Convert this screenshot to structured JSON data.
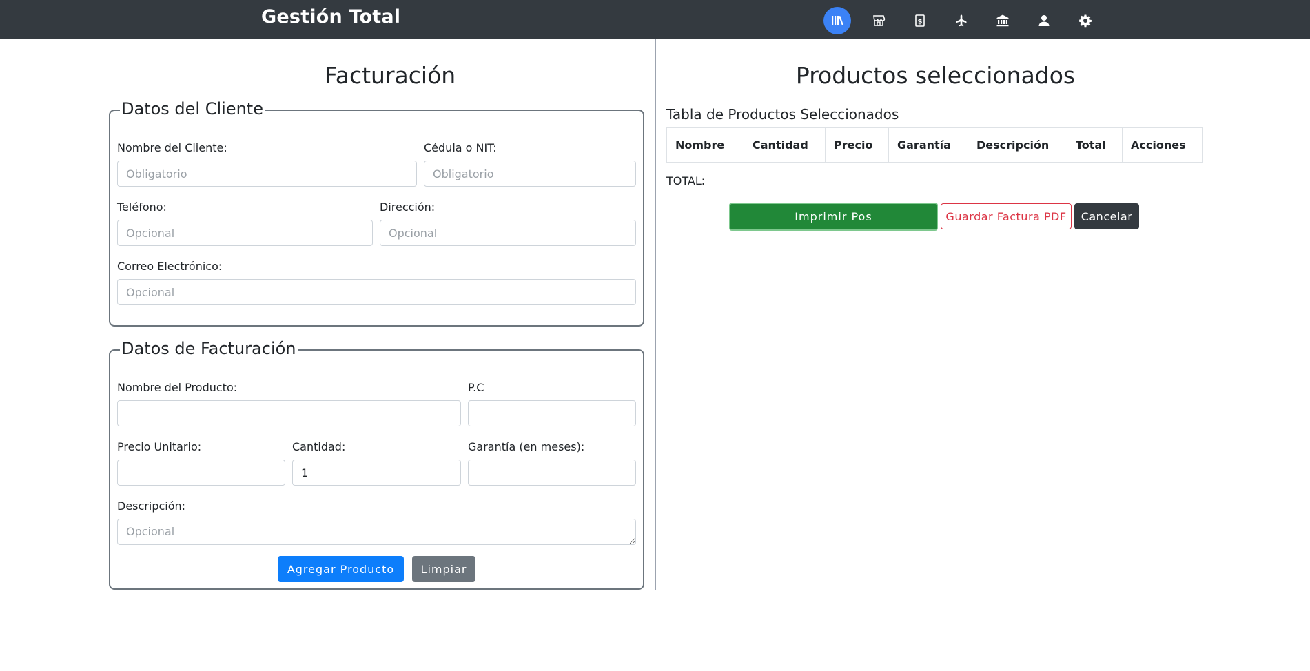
{
  "navbar": {
    "brand": "Gestión Total",
    "icons": [
      "books-icon",
      "store-icon",
      "invoice-dollar-icon",
      "plane-icon",
      "bank-icon",
      "user-icon",
      "gear-icon"
    ],
    "active_color": "#3b82f6"
  },
  "billing": {
    "title": "Facturación",
    "client": {
      "legend": "Datos del Cliente",
      "name_label": "Nombre del Cliente:",
      "name_placeholder": "Obligatorio",
      "id_label": "Cédula o NIT:",
      "id_placeholder": "Obligatorio",
      "phone_label": "Teléfono:",
      "phone_placeholder": "Opcional",
      "address_label": "Dirección:",
      "address_placeholder": "Opcional",
      "email_label": "Correo Electrónico:",
      "email_placeholder": "Opcional"
    },
    "invoice": {
      "legend": "Datos de Facturación",
      "product_label": "Nombre del Producto:",
      "product_value": "",
      "pc_label": "P.C",
      "pc_value": "",
      "price_label": "Precio Unitario:",
      "price_value": "",
      "qty_label": "Cantidad:",
      "qty_value": "1",
      "warranty_label": "Garantía (en meses):",
      "warranty_value": "",
      "desc_label": "Descripción:",
      "desc_placeholder": "Opcional",
      "add_button": "Agregar Producto",
      "clear_button": "Limpiar"
    }
  },
  "selected": {
    "title": "Productos seleccionados",
    "table_caption": "Tabla de Productos Seleccionados",
    "columns": [
      "Nombre",
      "Cantidad",
      "Precio",
      "Garantía",
      "Descripción",
      "Total",
      "Acciones"
    ],
    "total_label": "TOTAL:",
    "print_button": "Imprimir Pos",
    "pdf_button": "Guardar Factura PDF",
    "cancel_button": "Cancelar"
  }
}
